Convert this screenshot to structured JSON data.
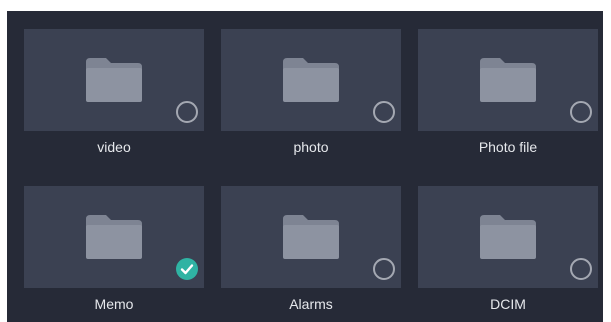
{
  "folders": [
    {
      "label": "video",
      "selected": false,
      "icon": "folder-icon"
    },
    {
      "label": "photo",
      "selected": false,
      "icon": "folder-icon"
    },
    {
      "label": "Photo file",
      "selected": false,
      "icon": "folder-icon"
    },
    {
      "label": "Memo",
      "selected": true,
      "icon": "folder-icon"
    },
    {
      "label": "Alarms",
      "selected": false,
      "icon": "folder-icon"
    },
    {
      "label": "DCIM",
      "selected": false,
      "icon": "folder-icon"
    }
  ],
  "colors": {
    "background": "#262a37",
    "tile": "#3b4152",
    "folder": "#8d93a1",
    "accent": "#2fb3a3"
  }
}
